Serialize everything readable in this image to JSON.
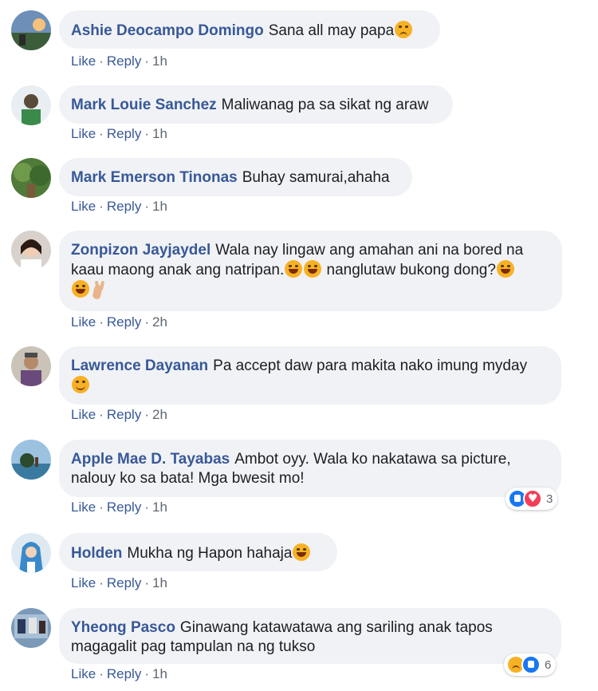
{
  "actions": {
    "like": "Like",
    "reply": "Reply",
    "separator": "·"
  },
  "comments": [
    {
      "author": "Ashie Deocampo Domingo",
      "text": "Sana all may papa",
      "emojis": [
        "sad-face-emoji"
      ],
      "time": "1h"
    },
    {
      "author": "Mark Louie Sanchez",
      "text": "Maliwanag pa sa sikat ng araw",
      "time": "1h"
    },
    {
      "author": "Mark Emerson Tinonas",
      "text": "Buhay samurai,ahaha",
      "time": "1h"
    },
    {
      "author": "Zonpizon Jayjaydel",
      "text": "Wala nay lingaw ang amahan ani na bored na kaau maong anak ang natripan.",
      "text2": " nanglutaw bukong dong?",
      "emojis": [
        "rofl-emoji",
        "rofl-emoji",
        "rofl-emoji",
        "laughing-tears-emoji",
        "peace-hand-emoji"
      ],
      "time": "2h"
    },
    {
      "author": "Lawrence Dayanan",
      "text": "Pa accept daw para makita nako imung myday",
      "emojis": [
        "grinning-sweat-emoji"
      ],
      "time": "2h"
    },
    {
      "author": "Apple Mae D. Tayabas",
      "text": "Ambot oyy. Wala ko nakatawa sa picture, nalouy ko sa bata! Mga bwesit mo!",
      "time": "1h",
      "reactions": {
        "icons": [
          "like-reaction-icon",
          "love-reaction-icon"
        ],
        "count": "3"
      }
    },
    {
      "author": "Holden",
      "text": "Mukha ng Hapon hahaja",
      "emojis": [
        "laughing-tears-emoji"
      ],
      "time": "1h"
    },
    {
      "author": "Yheong Pasco",
      "text": "Ginawang katawatawa ang sariling anak tapos magagalit pag tampulan na ng tukso",
      "time": "1h",
      "reactions": {
        "icons": [
          "sad-reaction-icon",
          "like-reaction-icon"
        ],
        "count": "6"
      }
    }
  ],
  "colors": {
    "author": "#385898",
    "bubble": "#f0f2f5",
    "text": "#1c1e21",
    "meta": "#606770"
  }
}
